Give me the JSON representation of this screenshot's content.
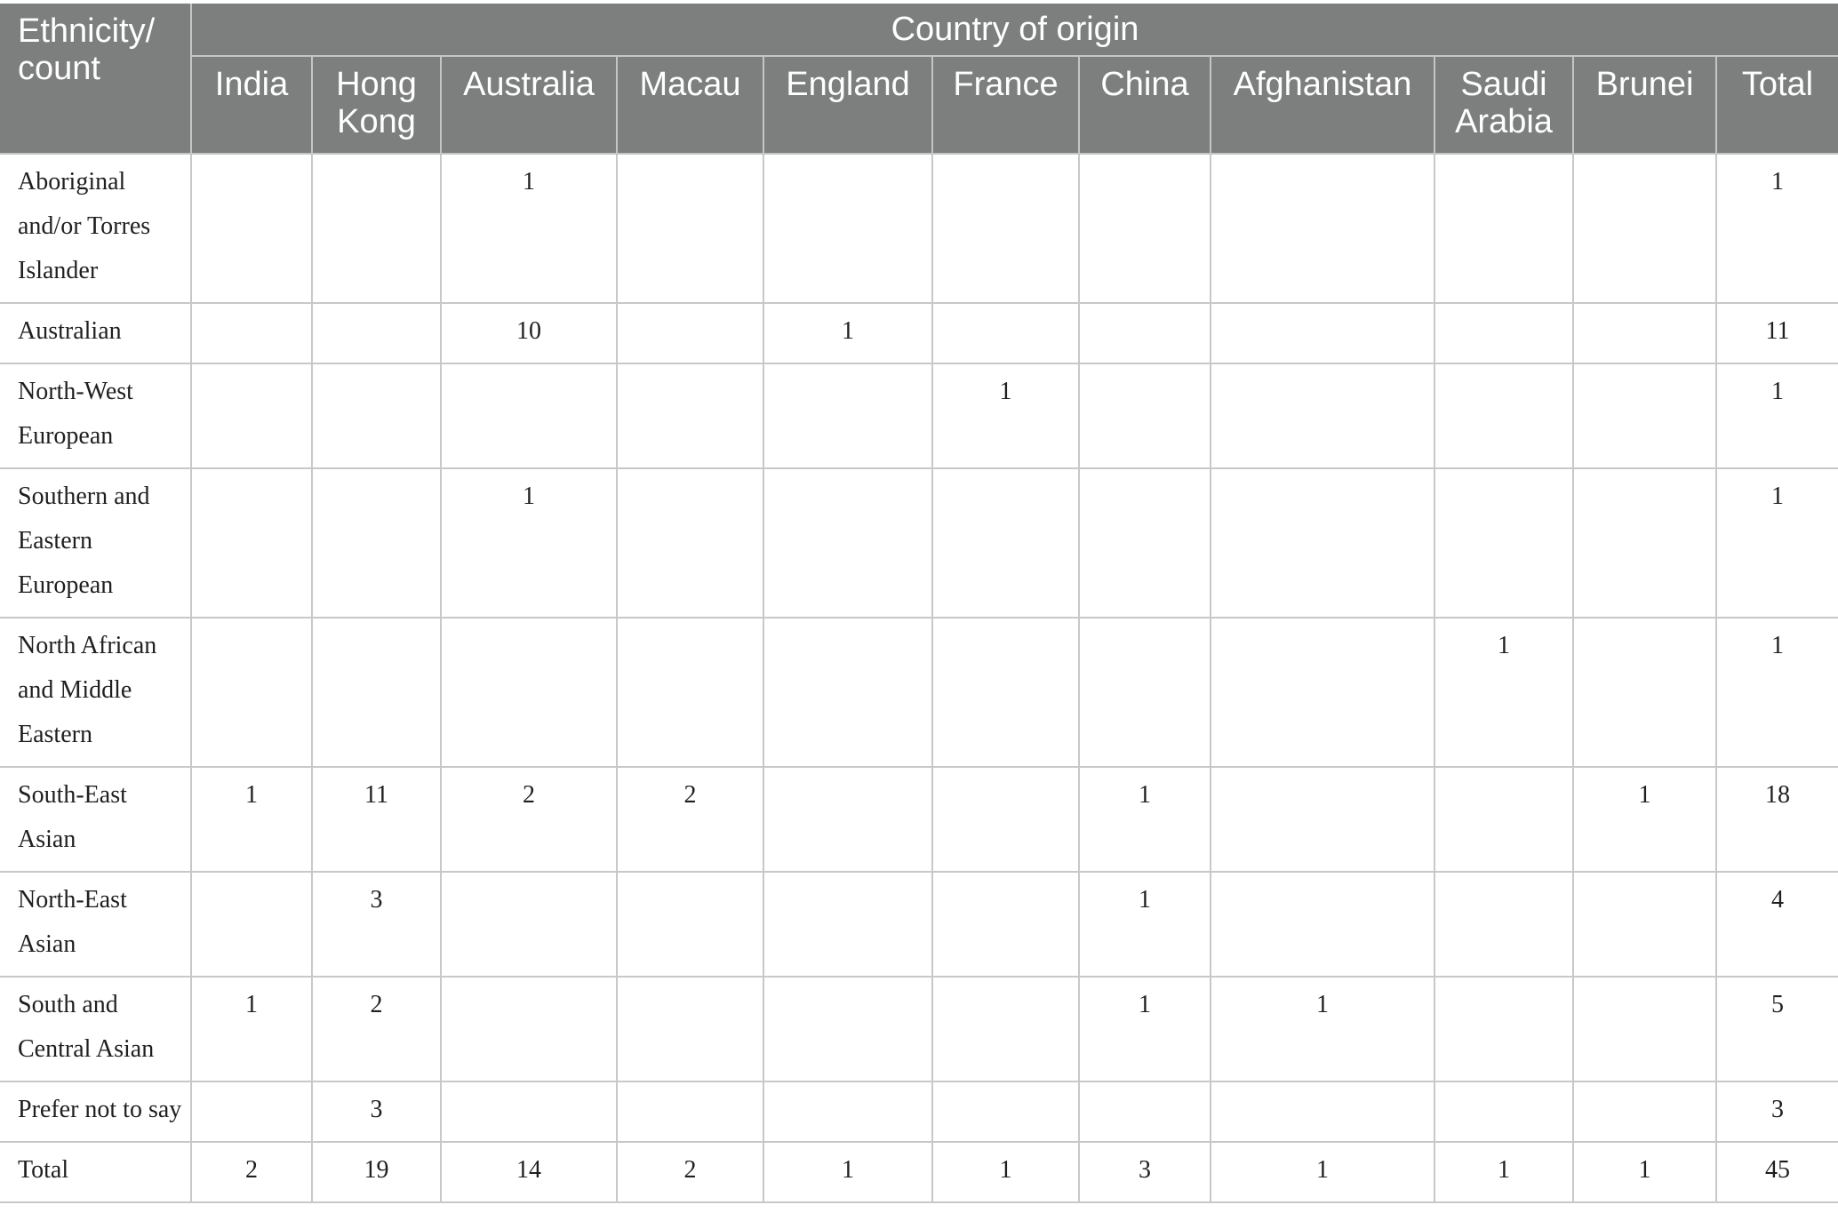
{
  "table": {
    "corner_label": "Ethnicity/ count",
    "group_header": "Country of origin",
    "columns": [
      "India",
      "Hong Kong",
      "Australia",
      "Macau",
      "England",
      "France",
      "China",
      "Afghanistan",
      "Saudi Arabia",
      "Brunei",
      "Total"
    ],
    "rows": [
      {
        "label": "Aboriginal and/or Torres Islander",
        "cells": [
          "",
          "",
          "1",
          "",
          "",
          "",
          "",
          "",
          "",
          "",
          "1"
        ]
      },
      {
        "label": "Australian",
        "cells": [
          "",
          "",
          "10",
          "",
          "1",
          "",
          "",
          "",
          "",
          "",
          "11"
        ]
      },
      {
        "label": "North-West European",
        "cells": [
          "",
          "",
          "",
          "",
          "",
          "1",
          "",
          "",
          "",
          "",
          "1"
        ]
      },
      {
        "label": "Southern and Eastern European",
        "cells": [
          "",
          "",
          "1",
          "",
          "",
          "",
          "",
          "",
          "",
          "",
          "1"
        ]
      },
      {
        "label": "North African and Middle Eastern",
        "cells": [
          "",
          "",
          "",
          "",
          "",
          "",
          "",
          "",
          "1",
          "",
          "1"
        ]
      },
      {
        "label": "South-East Asian",
        "cells": [
          "1",
          "11",
          "2",
          "2",
          "",
          "",
          "1",
          "",
          "",
          "1",
          "18"
        ]
      },
      {
        "label": "North-East Asian",
        "cells": [
          "",
          "3",
          "",
          "",
          "",
          "",
          "1",
          "",
          "",
          "",
          "4"
        ]
      },
      {
        "label": "South and Central Asian",
        "cells": [
          "1",
          "2",
          "",
          "",
          "",
          "",
          "1",
          "1",
          "",
          "",
          "5"
        ]
      },
      {
        "label": "Prefer not to say",
        "cells": [
          "",
          "3",
          "",
          "",
          "",
          "",
          "",
          "",
          "",
          "",
          "3"
        ]
      },
      {
        "label": "Total",
        "cells": [
          "2",
          "19",
          "14",
          "2",
          "1",
          "1",
          "3",
          "1",
          "1",
          "1",
          "45"
        ]
      }
    ]
  },
  "colors": {
    "header_background": "#7d7e7e",
    "header_text": "#ffffff",
    "grid_lines": "#c8c8c8"
  }
}
